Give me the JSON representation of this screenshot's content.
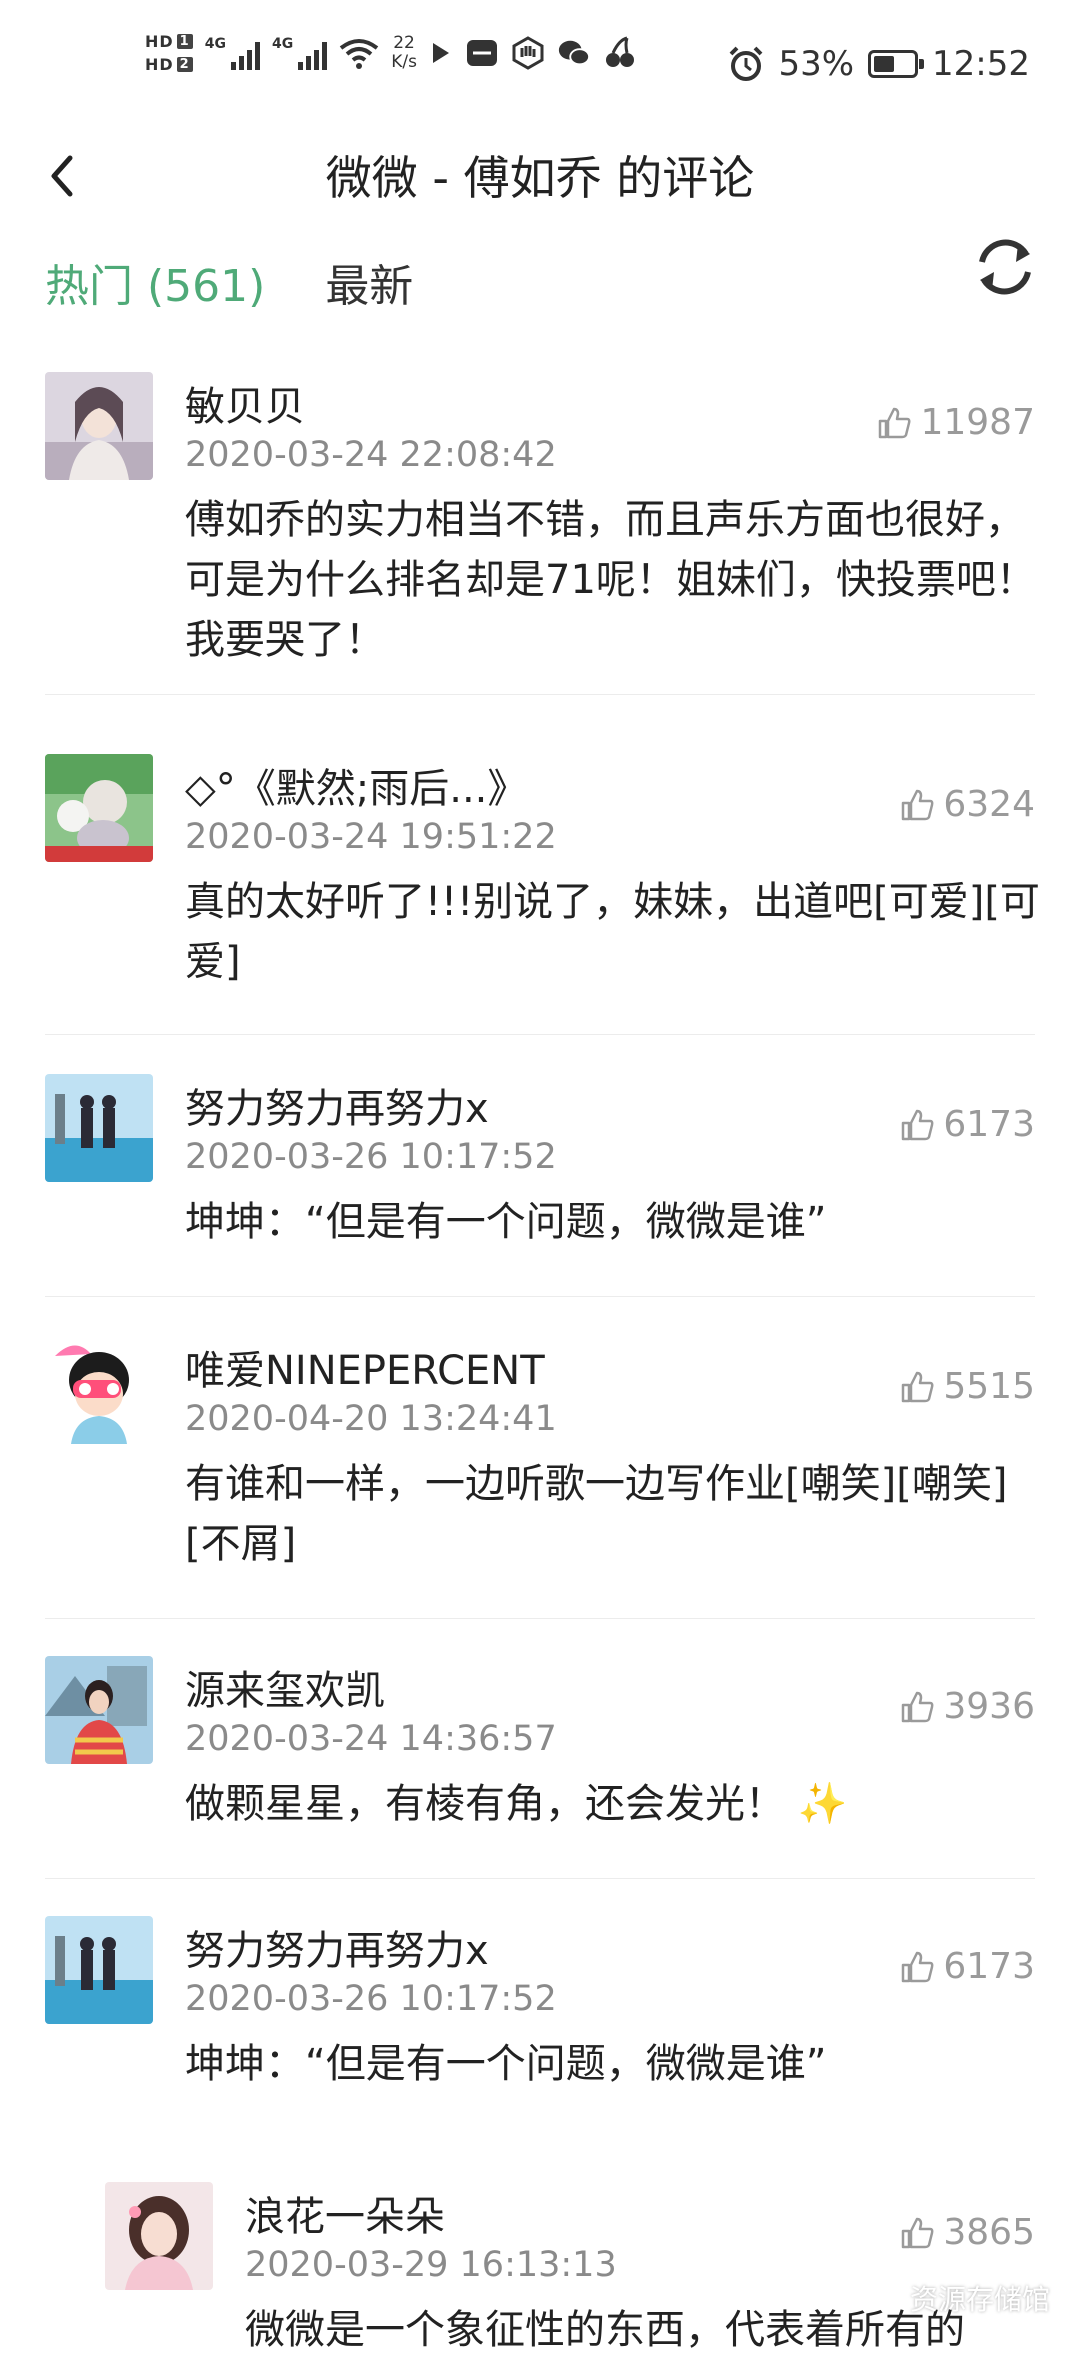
{
  "status_bar": {
    "hd1": "HD",
    "hd1_badge": "1",
    "hd2": "HD",
    "hd2_badge": "2",
    "sig1": "4G",
    "sig2": "4G",
    "net_value": "22",
    "net_unit": "K/s",
    "battery": "53%",
    "battery_level": 0.53,
    "time": "12:52"
  },
  "header": {
    "title": "微微 - 傅如乔 的评论"
  },
  "tabs": {
    "hot": "热门 (561)",
    "latest": "最新"
  },
  "comments": [
    {
      "user": "敏贝贝",
      "time": "2020-03-24 22:08:42",
      "likes": "11987",
      "text": "傅如乔的实力相当不错，而且声乐方面也很好，可是为什么排名却是71呢！姐妹们，快投票吧！我要哭了！"
    },
    {
      "user": "◇°《默然;雨后...》",
      "time": "2020-03-24 19:51:22",
      "likes": "6324",
      "text": "真的太好听了!!!别说了，妹妹，出道吧[可爱][可爱]"
    },
    {
      "user": "努力努力再努力x",
      "time": "2020-03-26 10:17:52",
      "likes": "6173",
      "text": "坤坤：“但是有一个问题，微微是谁”"
    },
    {
      "user": "唯爱NINEPERCENT",
      "time": "2020-04-20 13:24:41",
      "likes": "5515",
      "text": "有谁和一样，一边听歌一边写作业[嘲笑][嘲笑][不屑]"
    },
    {
      "user": "源来玺欢凯",
      "time": "2020-03-24 14:36:57",
      "likes": "3936",
      "text": "做颗星星，有棱有角，还会发光！ ✨"
    },
    {
      "user": "努力努力再努力x",
      "time": "2020-03-26 10:17:52",
      "likes": "6173",
      "text": "坤坤：“但是有一个问题，微微是谁”"
    },
    {
      "user": "浪花一朵朵",
      "time": "2020-03-29 16:13:13",
      "likes": "3865",
      "text": "微微是一个象征性的东西，代表着所有的"
    }
  ],
  "watermark": "资源存储馆",
  "colors": {
    "accent": "#4faa78",
    "text": "#222222",
    "secondary": "#8a8a8a"
  }
}
